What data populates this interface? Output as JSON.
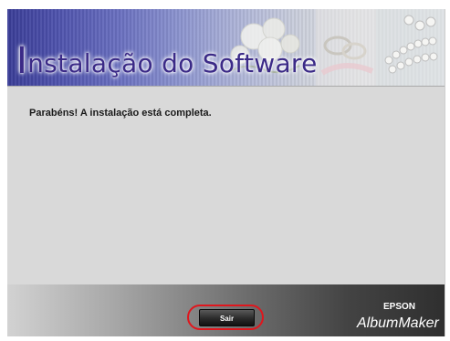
{
  "header": {
    "title_initial": "I",
    "title_rest": "nstalação do Software"
  },
  "main": {
    "message": "Parabéns! A instalação está completa."
  },
  "footer": {
    "exit_label": "Sair",
    "brand": "EPSON",
    "product": "AlbumMaker"
  },
  "colors": {
    "title": "#3b2a87",
    "highlight": "#e0161d",
    "footer_dark": "#2f2f2f"
  }
}
